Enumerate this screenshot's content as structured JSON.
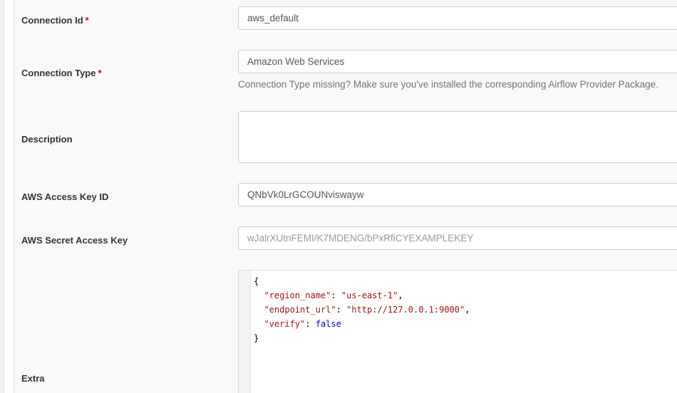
{
  "form": {
    "connection_id": {
      "label": "Connection Id",
      "required_mark": "*",
      "value": "aws_default"
    },
    "connection_type": {
      "label": "Connection Type",
      "required_mark": "*",
      "value": "Amazon Web Services",
      "help": "Connection Type missing? Make sure you've installed the corresponding Airflow Provider Package."
    },
    "description": {
      "label": "Description",
      "value": ""
    },
    "aws_access_key_id": {
      "label": "AWS Access Key ID",
      "value": "QNbVk0LrGCOUNviswayw"
    },
    "aws_secret_access_key": {
      "label": "AWS Secret Access Key",
      "placeholder": "wJalrXUtnFEMI/K7MDENG/bPxRfiCYEXAMPLEKEY"
    },
    "extra": {
      "label": "Extra",
      "lines": {
        "open": "{",
        "l1_key": "\"region_name\"",
        "l1_val": "\"us-east-1\"",
        "l2_key": "\"endpoint_url\"",
        "l2_val": "\"http://127.0.0.1:9000\"",
        "l3_key": "\"verify\"",
        "l3_val": "false",
        "close": "}"
      }
    }
  },
  "colors": {
    "required": "#cc0000",
    "json_string": "#a31515",
    "json_keyword": "#0000ff",
    "row_alt": "#f9f9f9"
  }
}
